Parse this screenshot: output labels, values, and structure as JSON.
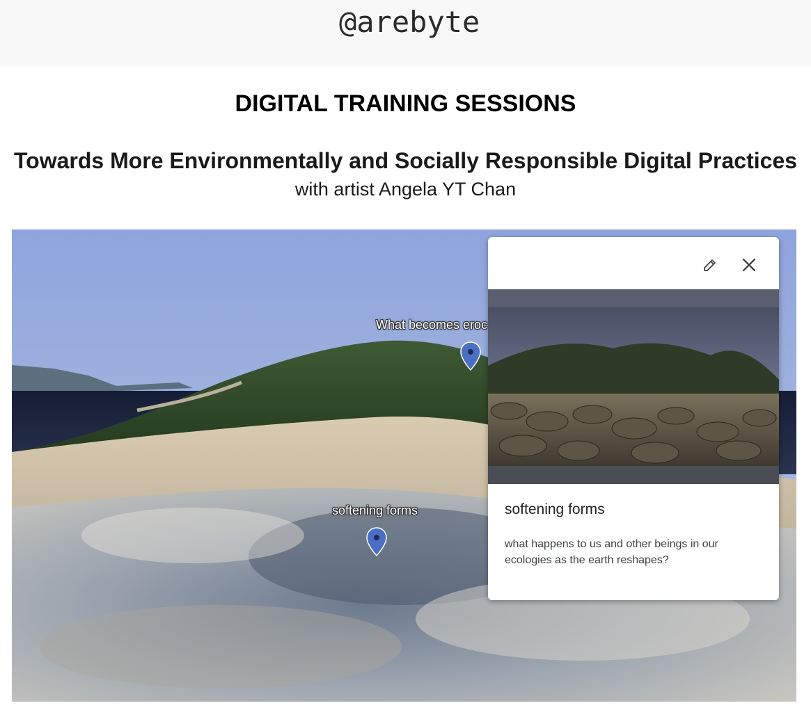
{
  "header": {
    "logo_text": "@arebyte"
  },
  "page": {
    "title": "DIGITAL TRAINING SESSIONS",
    "subtitle": "Towards More Environmentally and Socially Responsible Digital Practices",
    "byline": "with artist Angela YT Chan"
  },
  "map": {
    "pins": [
      {
        "label": "What becomes eroc"
      },
      {
        "label": "softening forms"
      }
    ]
  },
  "card": {
    "heading": "softening forms",
    "description": "what happens to us and other beings in our ecologies as the earth reshapes?",
    "edit_icon": "pencil-icon",
    "close_icon": "close-icon"
  },
  "colors": {
    "pin": "#4a6fc4",
    "sky_top": "#8fa6dc",
    "sea": "#1c2440"
  }
}
